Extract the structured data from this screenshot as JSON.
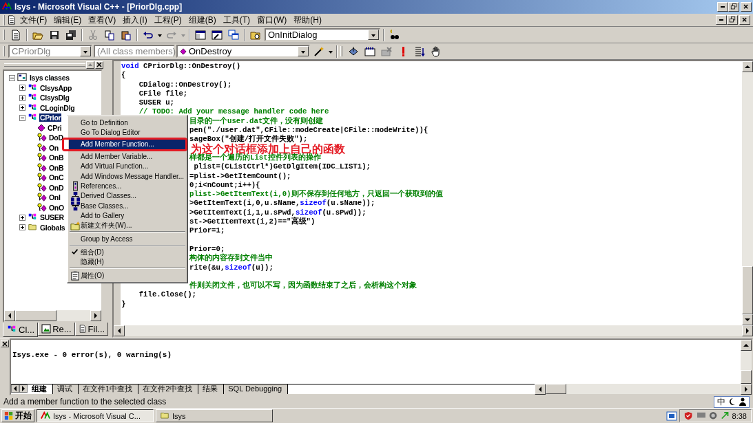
{
  "window": {
    "title": "Isys - Microsoft Visual C++ - [PriorDlg.cpp]"
  },
  "menu_bar": [
    {
      "label": "文件(F)"
    },
    {
      "label": "编辑(E)"
    },
    {
      "label": "查看(V)"
    },
    {
      "label": "插入(I)"
    },
    {
      "label": "工程(P)"
    },
    {
      "label": "组建(B)"
    },
    {
      "label": "工具(T)"
    },
    {
      "label": "窗口(W)"
    },
    {
      "label": "帮助(H)"
    }
  ],
  "toolbar": {
    "find_combo": "OnInitDialog"
  },
  "wizard_bar": {
    "class_combo": "CPriorDlg",
    "filter_combo": "(All class members)",
    "member_combo": "OnDestroy"
  },
  "class_view": {
    "tree": [
      {
        "label": "Isys classes",
        "kind": "root",
        "expanded": true,
        "selected": false,
        "children": [
          {
            "label": "CIsysApp",
            "kind": "class",
            "expanded": false,
            "selected": false
          },
          {
            "label": "CIsysDlg",
            "kind": "class",
            "expanded": false,
            "selected": false
          },
          {
            "label": "CLoginDlg",
            "kind": "class",
            "expanded": false,
            "selected": false
          },
          {
            "label": "CPrior",
            "kind": "class",
            "expanded": true,
            "selected": true,
            "children": [
              {
                "label": "CPri",
                "kind": "public-method",
                "selected": false
              },
              {
                "label": "DoD",
                "kind": "protected-method",
                "selected": false
              },
              {
                "label": "On",
                "kind": "protected-method",
                "selected": false
              },
              {
                "label": "OnB",
                "kind": "protected-method",
                "selected": false
              },
              {
                "label": "OnB",
                "kind": "protected-method",
                "selected": false
              },
              {
                "label": "OnC",
                "kind": "protected-method",
                "selected": false
              },
              {
                "label": "OnD",
                "kind": "protected-method",
                "selected": false
              },
              {
                "label": "OnI",
                "kind": "protected-method",
                "selected": false
              },
              {
                "label": "OnO",
                "kind": "protected-method",
                "selected": false
              }
            ]
          },
          {
            "label": "SUSER",
            "kind": "class",
            "expanded": false,
            "selected": false
          },
          {
            "label": "Globals",
            "kind": "folder",
            "expanded": false,
            "selected": false
          }
        ]
      }
    ],
    "tabs": [
      {
        "label": "Cl...",
        "selected": true
      },
      {
        "label": "Re...",
        "selected": false
      },
      {
        "label": "Fil...",
        "selected": false
      }
    ]
  },
  "editor": {
    "lines": [
      {
        "kind": "full",
        "segments": [
          {
            "text": "void",
            "kind": "keyword"
          },
          {
            "text": " CPriorDlg::OnDestroy()",
            "kind": "code"
          }
        ]
      },
      {
        "kind": "full",
        "segments": [
          {
            "text": "{",
            "kind": "code"
          }
        ]
      },
      {
        "kind": "full",
        "segments": [
          {
            "text": "    CDialog::OnDestroy();",
            "kind": "code"
          }
        ]
      },
      {
        "kind": "full",
        "segments": [
          {
            "text": "    CFile file;",
            "kind": "code"
          }
        ]
      },
      {
        "kind": "full",
        "segments": [
          {
            "text": "    SUSER u;",
            "kind": "code"
          }
        ]
      },
      {
        "kind": "full",
        "segments": [
          {
            "text": "    // TODO: Add your message handler code here",
            "kind": "comment"
          }
        ]
      },
      {
        "kind": "partial",
        "segments": [
          {
            "text": "目录的一个user.dat文件，没有则创建",
            "kind": "comment"
          }
        ]
      },
      {
        "kind": "partial",
        "segments": [
          {
            "text": "pen(\"./user.dat\",CFile::modeCreate|CFile::modeWrite)){",
            "kind": "code"
          }
        ]
      },
      {
        "kind": "partial",
        "segments": [
          {
            "text": "sageBox(\"创建/打开文件失败\");",
            "kind": "code"
          }
        ]
      },
      {
        "kind": "blank"
      },
      {
        "kind": "partial",
        "segments": [
          {
            "text": "样都是一个遍历的List控件列表的操作",
            "kind": "comment"
          }
        ]
      },
      {
        "kind": "partial",
        "segments": [
          {
            "text": " plist=(CListCtrl*)GetDlgItem(IDC_LIST1);",
            "kind": "code"
          }
        ]
      },
      {
        "kind": "partial",
        "segments": [
          {
            "text": "=plist->GetItemCount();",
            "kind": "code"
          }
        ]
      },
      {
        "kind": "partial",
        "segments": [
          {
            "text": "0;i<nCount;i++){",
            "kind": "code"
          }
        ]
      },
      {
        "kind": "partial",
        "segments": [
          {
            "text": "plist->GetItemText(i,0)则不保存到任何地方，只返回一个获取到的值",
            "kind": "comment"
          }
        ]
      },
      {
        "kind": "partial",
        "segments": [
          {
            "text": ">GetItemText(i,0,u.sName,",
            "kind": "code"
          },
          {
            "text": "sizeof",
            "kind": "keyword"
          },
          {
            "text": "(u.sName));",
            "kind": "code"
          }
        ]
      },
      {
        "kind": "partial",
        "segments": [
          {
            "text": ">GetItemText(i,1,u.sPwd,",
            "kind": "code"
          },
          {
            "text": "sizeof",
            "kind": "keyword"
          },
          {
            "text": "(u.sPwd));",
            "kind": "code"
          }
        ]
      },
      {
        "kind": "partial",
        "segments": [
          {
            "text": "st->GetItemText(i,2)==\"高级\")",
            "kind": "code"
          }
        ]
      },
      {
        "kind": "partial",
        "segments": [
          {
            "text": "Prior=1;",
            "kind": "code"
          }
        ]
      },
      {
        "kind": "blank"
      },
      {
        "kind": "partial",
        "segments": [
          {
            "text": "Prior=0;",
            "kind": "code"
          }
        ]
      },
      {
        "kind": "partial",
        "segments": [
          {
            "text": "构体的内容存到文件当中",
            "kind": "comment"
          }
        ]
      },
      {
        "kind": "partial",
        "segments": [
          {
            "text": "rite(&u,",
            "kind": "code"
          },
          {
            "text": "sizeof",
            "kind": "keyword"
          },
          {
            "text": "(u));",
            "kind": "code"
          }
        ]
      },
      {
        "kind": "blank"
      },
      {
        "kind": "partial",
        "segments": [
          {
            "text": "件则关闭文件，也可以不写，因为函数结束了之后，会析构这个对象",
            "kind": "comment"
          }
        ]
      },
      {
        "kind": "full",
        "segments": [
          {
            "text": "    file.Close();",
            "kind": "code"
          }
        ]
      },
      {
        "kind": "full",
        "segments": [
          {
            "text": "}",
            "kind": "code"
          }
        ]
      }
    ]
  },
  "context_menu": {
    "items": [
      {
        "kind": "item",
        "label": "Go to Definition",
        "selected": false,
        "checked": false
      },
      {
        "kind": "item",
        "label": "Go To Dialog Editor",
        "selected": false,
        "checked": false
      },
      {
        "kind": "item",
        "label": "Add Member Function...",
        "selected": true,
        "checked": false
      },
      {
        "kind": "item",
        "label": "Add Member Variable...",
        "selected": false,
        "checked": false
      },
      {
        "kind": "item",
        "label": "Add Virtual Function...",
        "selected": false,
        "checked": false
      },
      {
        "kind": "item",
        "label": "Add Windows Message Handler...",
        "selected": false,
        "checked": false
      },
      {
        "kind": "item",
        "label": "References...",
        "selected": false,
        "checked": false
      },
      {
        "kind": "item",
        "label": "Derived Classes...",
        "selected": false,
        "checked": false
      },
      {
        "kind": "item",
        "label": "Base Classes...",
        "selected": false,
        "checked": false
      },
      {
        "kind": "item",
        "label": "Add to Gallery",
        "selected": false,
        "checked": false
      },
      {
        "kind": "item",
        "label": "新建文件夹(W)...",
        "selected": false,
        "checked": false
      },
      {
        "kind": "separator"
      },
      {
        "kind": "item",
        "label": "Group by Access",
        "selected": false,
        "checked": false
      },
      {
        "kind": "separator"
      },
      {
        "kind": "item",
        "label": "组合(D)",
        "selected": false,
        "checked": true
      },
      {
        "kind": "item",
        "label": "隐藏(H)",
        "selected": false,
        "checked": false
      },
      {
        "kind": "separator"
      },
      {
        "kind": "item",
        "label": "属性(O)",
        "selected": false,
        "checked": false
      }
    ]
  },
  "annotation": {
    "text": "为这个对话框添加上自己的函数"
  },
  "output": {
    "text": "Isys.exe - 0 error(s), 0 warning(s)",
    "tabs": [
      {
        "label": "组建",
        "selected": true
      },
      {
        "label": "调试",
        "selected": false
      },
      {
        "label": "在文件1中查找",
        "selected": false
      },
      {
        "label": "在文件2中查找",
        "selected": false
      },
      {
        "label": "结果",
        "selected": false
      },
      {
        "label": "SQL Debugging",
        "selected": false
      }
    ]
  },
  "status_bar": {
    "message": "Add a member function to the selected class",
    "ime": "中"
  },
  "taskbar": {
    "start": "开始",
    "tasks": [
      {
        "label": "Isys - Microsoft Visual C...",
        "selected": true
      },
      {
        "label": "Isys",
        "selected": false
      }
    ],
    "clock": "8:38"
  }
}
